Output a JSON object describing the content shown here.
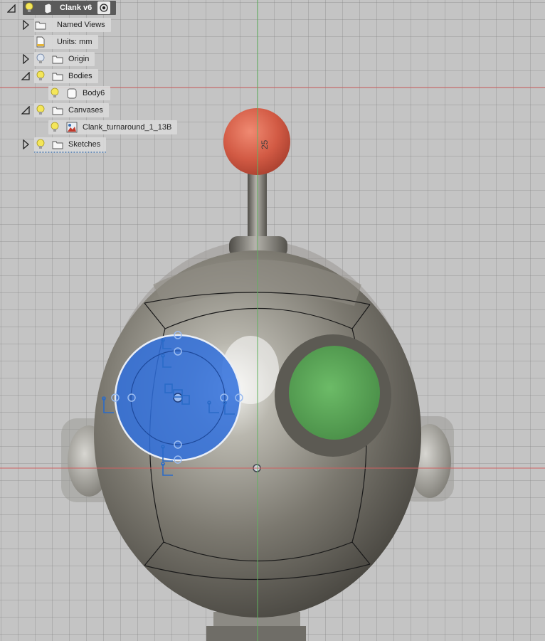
{
  "browser": {
    "root": {
      "label": "Clank v6",
      "icons": [
        "collapse-triangle-icon",
        "lightbulb-icon",
        "component-icon",
        "activate-radio-icon"
      ]
    },
    "items": [
      {
        "label": "Named Views",
        "icons": [
          "expand-triangle-icon",
          "folder-icon"
        ]
      },
      {
        "label": "Units: mm",
        "icons": [
          "units-document-icon"
        ]
      },
      {
        "label": "Origin",
        "icons": [
          "expand-triangle-icon",
          "lightbulb-icon",
          "folder-icon"
        ]
      },
      {
        "label": "Bodies",
        "icons": [
          "collapse-triangle-icon",
          "lightbulb-icon",
          "folder-icon"
        ]
      },
      {
        "label": "Body6",
        "icons": [
          "lightbulb-icon",
          "body-icon"
        ]
      },
      {
        "label": "Canvases",
        "icons": [
          "collapse-triangle-icon",
          "lightbulb-icon",
          "folder-icon"
        ]
      },
      {
        "label": "Clank_turnaround_1_13B",
        "icons": [
          "lightbulb-icon",
          "canvas-image-icon"
        ]
      },
      {
        "label": "Sketches",
        "icons": [
          "expand-triangle-icon",
          "lightbulb-icon",
          "folder-icon"
        ]
      }
    ]
  },
  "viewport": {
    "dimension_label": "25",
    "colors": {
      "grid_bg": "#c4c4c4",
      "axis_red": "#d06060",
      "axis_green": "#5fb35f",
      "selected_sketch": "#2f6fdc",
      "antenna_ball": "#d8634c",
      "eye_green": "#5aa85a",
      "body_metal": "#7c7a72"
    }
  }
}
